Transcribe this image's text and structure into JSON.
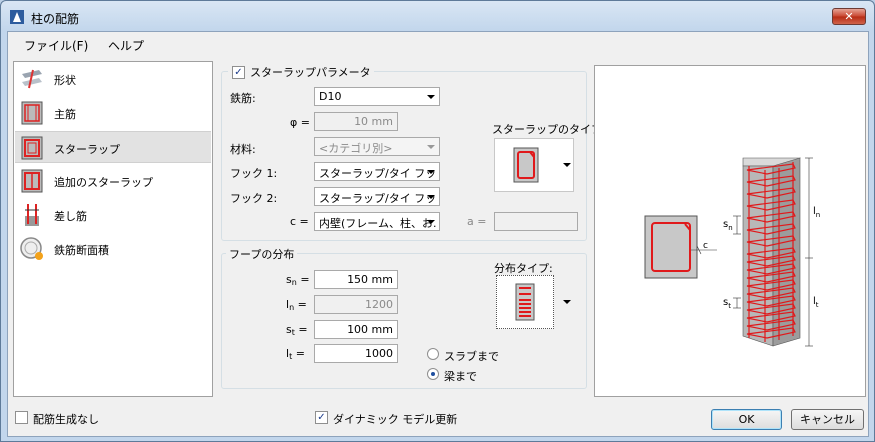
{
  "window": {
    "title": "柱の配筋",
    "close_label": "✕"
  },
  "menu": {
    "file": "ファイル(F)",
    "help": "ヘルプ"
  },
  "nav": {
    "items": [
      {
        "label": "形状",
        "icon": "shape-icon"
      },
      {
        "label": "主筋",
        "icon": "main-bar-icon"
      },
      {
        "label": "スターラップ",
        "icon": "stirrup-icon",
        "selected": true
      },
      {
        "label": "追加のスターラップ",
        "icon": "additional-stirrup-icon"
      },
      {
        "label": "差し筋",
        "icon": "dowel-icon"
      },
      {
        "label": "鉄筋断面積",
        "icon": "rebar-area-icon"
      }
    ]
  },
  "stirrup_params": {
    "group_label": "スターラップパラメータ",
    "checked": true,
    "rebar_label": "鉄筋:",
    "rebar_value": "D10",
    "phi_label": "φ =",
    "phi_value": "10 mm",
    "material_label": "材料:",
    "material_value": "<カテゴリ別>",
    "hook1_label": "フック 1:",
    "hook1_value": "スターラップ/タイ フッ",
    "hook2_label": "フック 2:",
    "hook2_value": "スターラップ/タイ フッ",
    "c_label": "c =",
    "c_value": "内壁(フレーム、柱、お.",
    "a_label": "a =",
    "a_value": "",
    "type_label": "スターラップのタイプ"
  },
  "hoop": {
    "group_label": "フープの分布",
    "sn_label": "s",
    "sn_sub": "n",
    "sn_value": "150 mm",
    "ln_label": "l",
    "ln_sub": "n",
    "ln_value": "1200",
    "st_label": "s",
    "st_sub": "t",
    "st_value": "100 mm",
    "lt_label": "l",
    "lt_sub": "t",
    "lt_value": "1000",
    "eq": "=",
    "dist_type_label": "分布タイプ:",
    "radio_slab": "スラブまで",
    "radio_beam": "梁まで",
    "selected_radio": "beam"
  },
  "preview": {
    "c": "c",
    "sn": "s",
    "sn_sub": "n",
    "st": "s",
    "st_sub": "t",
    "ln": "l",
    "ln_sub": "n",
    "lt": "l",
    "lt_sub": "t"
  },
  "footer": {
    "no_generate": "配筋生成なし",
    "dynamic_update": "ダイナミック モデル更新",
    "dynamic_checked": true,
    "ok": "OK",
    "cancel": "キャンセル"
  },
  "colors": {
    "rebar": "#e0191b",
    "concrete": "#c8c8c8",
    "titlebar": "#c2d6ec"
  }
}
